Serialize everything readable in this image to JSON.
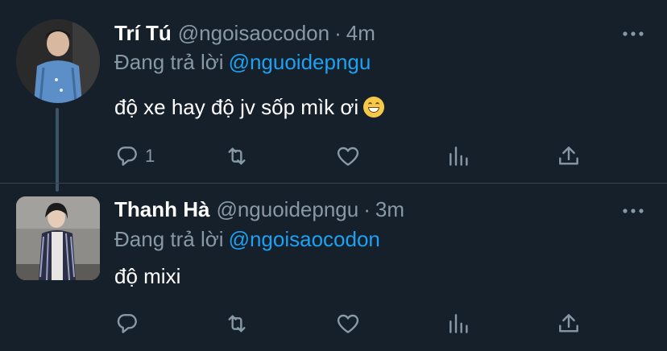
{
  "tweets": [
    {
      "name": "Trí Tú",
      "handle": "@ngoisaocodon",
      "dot": "·",
      "time": "4m",
      "reply_prefix": "Đang trả lời",
      "reply_to": "@nguoidepngu",
      "text": "độ xe hay độ jv sốp mìk ơi",
      "emoji": "grinning-face-emoji",
      "reply_count": "1"
    },
    {
      "name": "Thanh Hà",
      "handle": "@nguoidepngu",
      "dot": "·",
      "time": "3m",
      "reply_prefix": "Đang trả lời",
      "reply_to": "@ngoisaocodon",
      "text": "độ mixi",
      "reply_count": ""
    }
  ],
  "icons": {
    "reply": "reply-icon",
    "retweet": "retweet-icon",
    "like": "heart-icon",
    "stats": "bar-chart-icon",
    "share": "share-icon",
    "more": "more-dots-icon"
  },
  "colors": {
    "background": "#15202b",
    "secondary_text": "#8899a6",
    "link": "#1da1f2",
    "thread_line": "#3d5466"
  }
}
